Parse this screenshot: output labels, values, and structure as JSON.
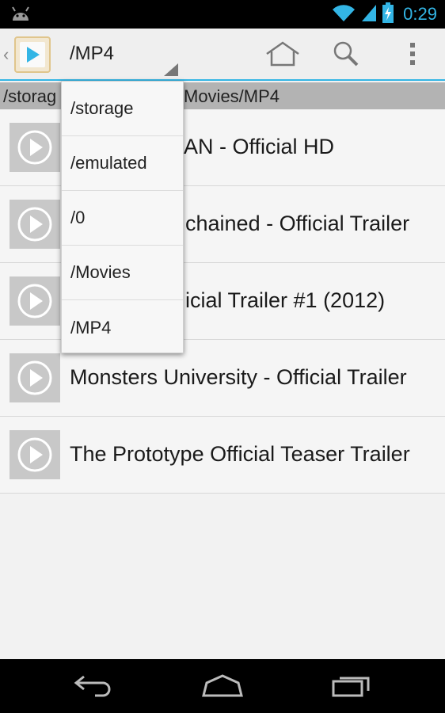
{
  "status_bar": {
    "time": "0:29",
    "icons": [
      "android-icon",
      "wifi-icon",
      "signal-icon",
      "battery-charging-icon"
    ]
  },
  "action_bar": {
    "current_folder": "/MP4",
    "icons": [
      "app-icon",
      "home-icon",
      "search-icon",
      "overflow-icon"
    ]
  },
  "path_bar": {
    "prefix": "/storag",
    "suffix": "Movies/MP4"
  },
  "dropdown": {
    "items": [
      "/storage",
      "/emulated",
      "/0",
      "/Movies",
      "/MP4"
    ]
  },
  "files": [
    {
      "title": "AN - Official HD"
    },
    {
      "title": "chained - Official Trailer"
    },
    {
      "title": "icial Trailer #1 (2012)"
    },
    {
      "title": "Monsters University - Official Trailer"
    },
    {
      "title": "The Prototype Official Teaser Trailer"
    }
  ],
  "navigation_bar": {
    "icons": [
      "back-icon",
      "home-icon",
      "recent-apps-icon"
    ]
  },
  "colors": {
    "accent": "#33b5e5",
    "status_bar": "#000000",
    "path_bar": "#b3b3b3"
  }
}
